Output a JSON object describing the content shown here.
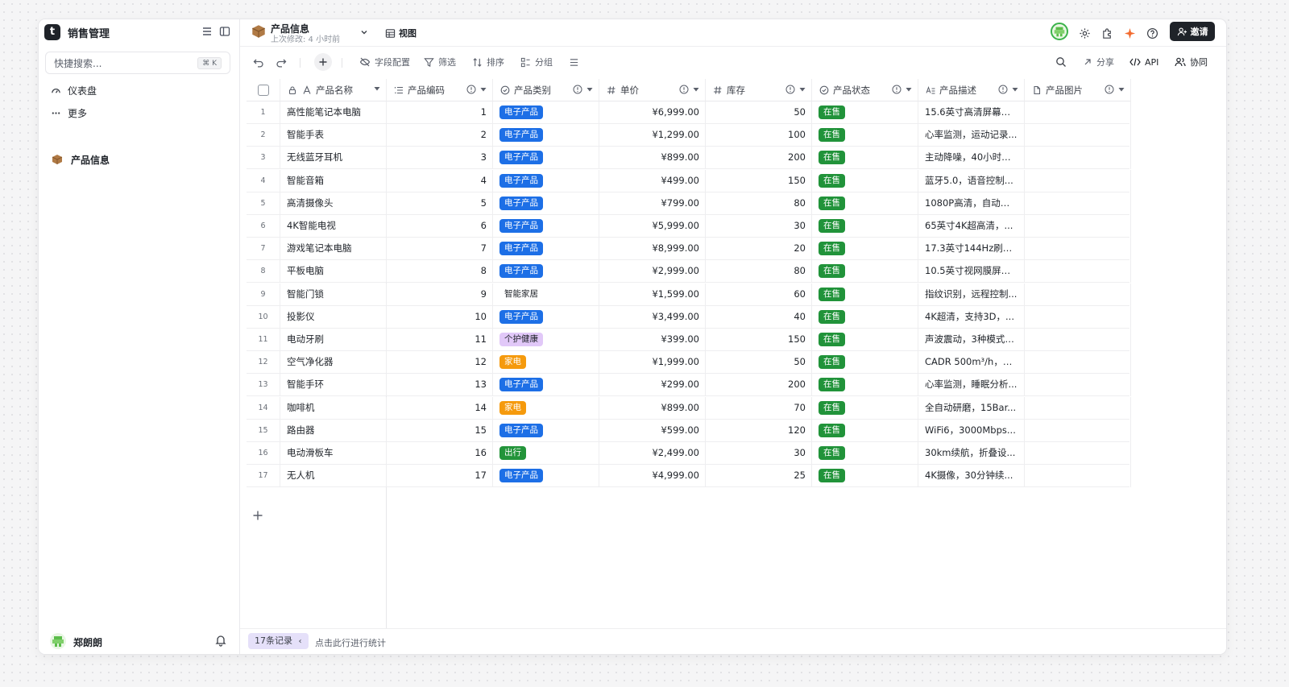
{
  "app": {
    "name": "销售管理",
    "logo_letter": "t"
  },
  "sidebar": {
    "search_placeholder": "快捷搜索...",
    "search_shortcut": "⌘ K",
    "nav": [
      {
        "label": "仪表盘",
        "icon": "dashboard-icon"
      },
      {
        "label": "更多",
        "icon": "more-icon"
      }
    ],
    "tables": [
      {
        "label": "产品信息",
        "icon": "box-icon"
      }
    ],
    "user": {
      "name": "郑朗朗"
    }
  },
  "header": {
    "title": "产品信息",
    "subtitle": "上次修改: 4 小时前",
    "view_label": "视图",
    "invite_label": "邀请"
  },
  "toolbar": {
    "field_config": "字段配置",
    "filter": "筛选",
    "sort": "排序",
    "group": "分组",
    "share": "分享",
    "api": "API",
    "collab": "协同"
  },
  "table": {
    "columns": [
      {
        "label": "产品名称",
        "icon": "text-icon"
      },
      {
        "label": "产品编码",
        "icon": "autonumber-icon"
      },
      {
        "label": "产品类别",
        "icon": "select-icon"
      },
      {
        "label": "单价",
        "icon": "number-icon"
      },
      {
        "label": "库存",
        "icon": "number-icon"
      },
      {
        "label": "产品状态",
        "icon": "select-icon"
      },
      {
        "label": "产品描述",
        "icon": "longtext-icon"
      },
      {
        "label": "产品图片",
        "icon": "attachment-icon"
      }
    ],
    "rows": [
      {
        "n": "1",
        "name": "高性能笔记本电脑",
        "code": "1",
        "cat": "电子产品",
        "price": "¥6,999.00",
        "stock": "50",
        "status": "在售",
        "desc": "15.6英寸高清屏幕，..."
      },
      {
        "n": "2",
        "name": "智能手表",
        "code": "2",
        "cat": "电子产品",
        "price": "¥1,299.00",
        "stock": "100",
        "status": "在售",
        "desc": "心率监测，运动记录..."
      },
      {
        "n": "3",
        "name": "无线蓝牙耳机",
        "code": "3",
        "cat": "电子产品",
        "price": "¥899.00",
        "stock": "200",
        "status": "在售",
        "desc": "主动降噪，40小时续..."
      },
      {
        "n": "4",
        "name": "智能音箱",
        "code": "4",
        "cat": "电子产品",
        "price": "¥499.00",
        "stock": "150",
        "status": "在售",
        "desc": "蓝牙5.0，语音控制..."
      },
      {
        "n": "5",
        "name": "高清摄像头",
        "code": "5",
        "cat": "电子产品",
        "price": "¥799.00",
        "stock": "80",
        "status": "在售",
        "desc": "1080P高清，自动对..."
      },
      {
        "n": "6",
        "name": "4K智能电视",
        "code": "6",
        "cat": "电子产品",
        "price": "¥5,999.00",
        "stock": "30",
        "status": "在售",
        "desc": "65英寸4K超高清，..."
      },
      {
        "n": "7",
        "name": "游戏笔记本电脑",
        "code": "7",
        "cat": "电子产品",
        "price": "¥8,999.00",
        "stock": "20",
        "status": "在售",
        "desc": "17.3英寸144Hz刷新..."
      },
      {
        "n": "8",
        "name": "平板电脑",
        "code": "8",
        "cat": "电子产品",
        "price": "¥2,999.00",
        "stock": "80",
        "status": "在售",
        "desc": "10.5英寸视网膜屏，..."
      },
      {
        "n": "9",
        "name": "智能门锁",
        "code": "9",
        "cat": "智能家居",
        "price": "¥1,599.00",
        "stock": "60",
        "status": "在售",
        "desc": "指纹识别，远程控制..."
      },
      {
        "n": "10",
        "name": "投影仪",
        "code": "10",
        "cat": "电子产品",
        "price": "¥3,499.00",
        "stock": "40",
        "status": "在售",
        "desc": "4K超清，支持3D，..."
      },
      {
        "n": "11",
        "name": "电动牙刷",
        "code": "11",
        "cat": "个护健康",
        "price": "¥399.00",
        "stock": "150",
        "status": "在售",
        "desc": "声波震动，3种模式，..."
      },
      {
        "n": "12",
        "name": "空气净化器",
        "code": "12",
        "cat": "家电",
        "price": "¥1,999.00",
        "stock": "50",
        "status": "在售",
        "desc": "CADR 500m³/h，智..."
      },
      {
        "n": "13",
        "name": "智能手环",
        "code": "13",
        "cat": "电子产品",
        "price": "¥299.00",
        "stock": "200",
        "status": "在售",
        "desc": "心率监测，睡眠分析..."
      },
      {
        "n": "14",
        "name": "咖啡机",
        "code": "14",
        "cat": "家电",
        "price": "¥899.00",
        "stock": "70",
        "status": "在售",
        "desc": "全自动研磨，15Bar..."
      },
      {
        "n": "15",
        "name": "路由器",
        "code": "15",
        "cat": "电子产品",
        "price": "¥599.00",
        "stock": "120",
        "status": "在售",
        "desc": "WiFi6，3000Mbps..."
      },
      {
        "n": "16",
        "name": "电动滑板车",
        "code": "16",
        "cat": "出行",
        "price": "¥2,499.00",
        "stock": "30",
        "status": "在售",
        "desc": "30km续航，折叠设..."
      },
      {
        "n": "17",
        "name": "无人机",
        "code": "17",
        "cat": "电子产品",
        "price": "¥4,999.00",
        "stock": "25",
        "status": "在售",
        "desc": "4K摄像，30分钟续..."
      }
    ],
    "category_colors": {
      "电子产品": {
        "bg": "#1d6fe6",
        "fg": "#ffffff"
      },
      "智能家居": {
        "bg": "#ffffff",
        "fg": "#1f2329"
      },
      "个护健康": {
        "bg": "#e1c8f8",
        "fg": "#1f2329"
      },
      "家电": {
        "bg": "#f59a0d",
        "fg": "#ffffff"
      },
      "出行": {
        "bg": "#23943a",
        "fg": "#ffffff"
      }
    },
    "status_color": {
      "bg": "#21933a",
      "fg": "#ffffff"
    }
  },
  "footer": {
    "records_label": "17条记录",
    "stats_hint": "点击此行进行统计"
  }
}
